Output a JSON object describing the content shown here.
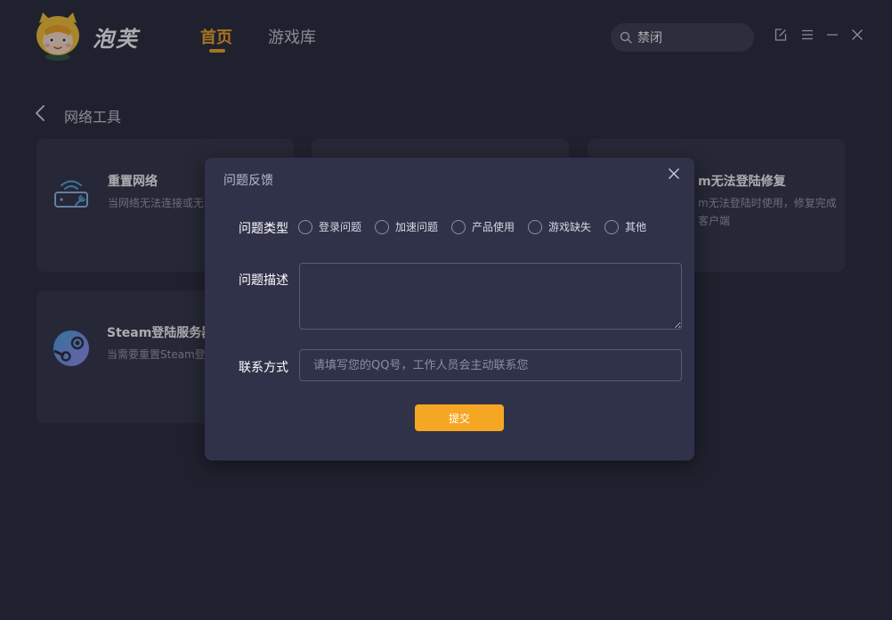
{
  "app": {
    "brand": "泡芙",
    "nav": {
      "home": "首页",
      "library": "游戏库"
    },
    "search": {
      "value": "禁闭"
    },
    "window_icons": [
      "feedback-edit-icon",
      "menu-icon",
      "minimize-icon",
      "close-icon"
    ]
  },
  "page": {
    "title": "网络工具",
    "cards": [
      {
        "title": "重置网络",
        "desc": "当网络无法连接或无"
      },
      {
        "title": "Steam登陆服务器",
        "desc": "当需要重置Steam登"
      },
      {
        "title": "m无法登陆修复",
        "desc_line1": "m无法登陆时使用，修复完成",
        "desc_line2": "客户端"
      }
    ]
  },
  "dialog": {
    "title": "问题反馈",
    "type_label": "问题类型",
    "types": [
      "登录问题",
      "加速问题",
      "产品使用",
      "游戏缺失",
      "其他"
    ],
    "desc_label": "问题描述",
    "contact_label": "联系方式",
    "contact_placeholder": "请填写您的QQ号，工作人员会主动联系您",
    "submit_label": "提交"
  },
  "colors": {
    "background": "#262838",
    "card": "#313346",
    "dialog": "#30324a",
    "accent": "#f5a623"
  }
}
